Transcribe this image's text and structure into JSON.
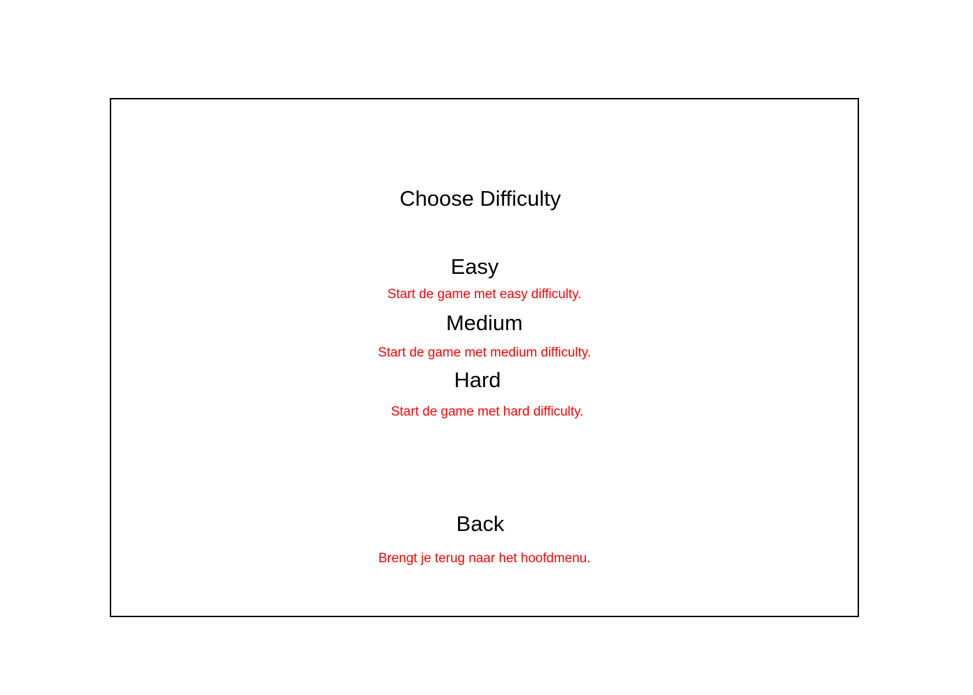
{
  "screen": {
    "title": "Choose Difficulty"
  },
  "options": [
    {
      "label": "Easy",
      "description": "Start de game met easy difficulty."
    },
    {
      "label": "Medium",
      "description": "Start de game met medium difficulty."
    },
    {
      "label": "Hard",
      "description": "Start de game met hard difficulty."
    }
  ],
  "back": {
    "label": "Back",
    "description": "Brengt je terug naar het hoofdmenu."
  },
  "colors": {
    "description_text": "#ff0000",
    "label_text": "#000000",
    "frame_border": "#000000"
  }
}
